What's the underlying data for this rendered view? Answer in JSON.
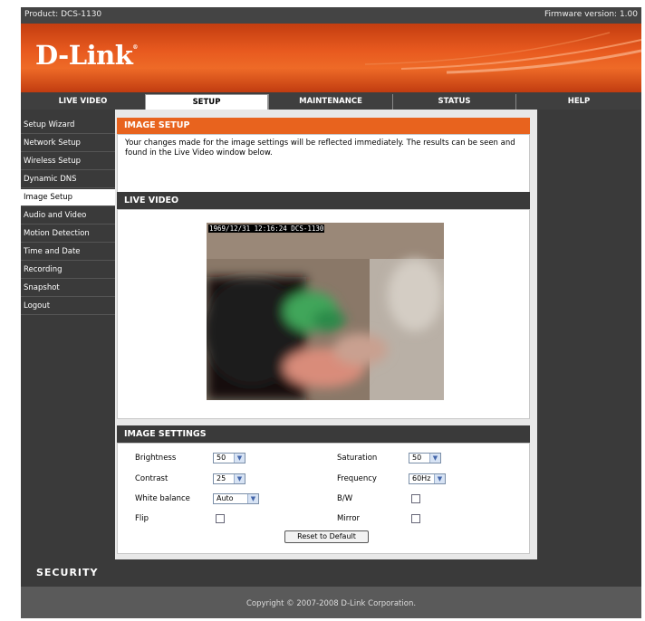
{
  "header": {
    "product": "Product: DCS-1130",
    "firmware": "Firmware version: 1.00",
    "logo": "D-Link",
    "logo_mark": "®"
  },
  "nav": {
    "tabs": [
      "LIVE VIDEO",
      "SETUP",
      "MAINTENANCE",
      "STATUS",
      "HELP"
    ],
    "active": "SETUP"
  },
  "sidebar": {
    "items": [
      "Setup Wizard",
      "Network Setup",
      "Wireless Setup",
      "Dynamic DNS",
      "Image Setup",
      "Audio and Video",
      "Motion Detection",
      "Time and Date",
      "Recording",
      "Snapshot",
      "Logout"
    ],
    "active": "Image Setup"
  },
  "image_setup": {
    "title": "IMAGE SETUP",
    "description": "Your changes made for the image settings will be reflected immediately. The results can be seen and found in the Live Video window below."
  },
  "live_video": {
    "title": "LIVE VIDEO",
    "timestamp": "1969/12/31 12:16:24 DCS-1130"
  },
  "image_settings": {
    "title": "IMAGE SETTINGS",
    "brightness_label": "Brightness",
    "brightness_value": "50",
    "contrast_label": "Contrast",
    "contrast_value": "25",
    "white_balance_label": "White balance",
    "white_balance_value": "Auto",
    "flip_label": "Flip",
    "saturation_label": "Saturation",
    "saturation_value": "50",
    "frequency_label": "Frequency",
    "frequency_value": "60Hz",
    "bw_label": "B/W",
    "mirror_label": "Mirror",
    "reset_label": "Reset to Default"
  },
  "security_label": "SECURITY",
  "copyright": "Copyright © 2007-2008 D-Link Corporation.",
  "colors": {
    "orange": "#e8631e",
    "dark": "#3a3a3a"
  }
}
